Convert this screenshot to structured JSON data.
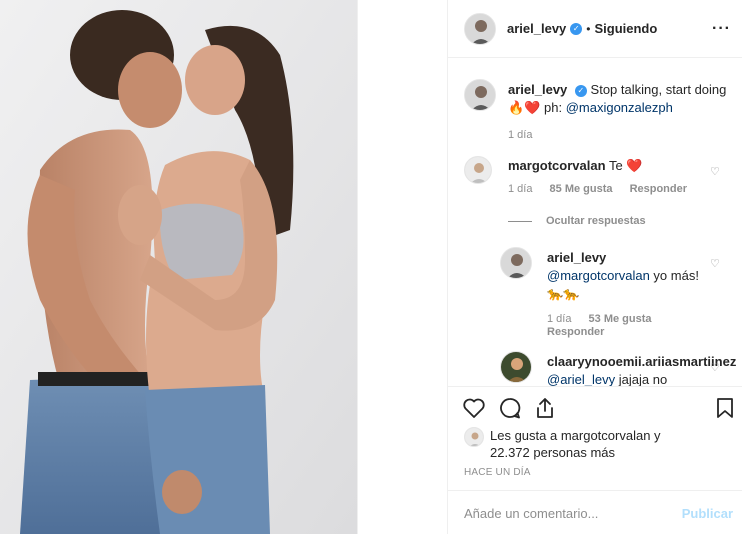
{
  "post": {
    "image_alt": "Foto de pareja besándose",
    "author": "ariel_levy",
    "follow_state": "Siguiendo",
    "separator": "•",
    "more_icon": "more-horizontal-icon"
  },
  "caption": {
    "username": "ariel_levy",
    "text": "Stop talking, start doing",
    "emojis": "🔥❤️",
    "credit_prefix": "ph:",
    "credit_mention": "@maxigonzalezph",
    "time": "1 día"
  },
  "comments": [
    {
      "username": "margotcorvalan",
      "text": "Te",
      "emoji": "❤️",
      "time": "1 día",
      "likes": "85 Me gusta",
      "reply": "Responder"
    }
  ],
  "replies_toggle": "Ocultar respuestas",
  "replies": [
    {
      "username": "ariel_levy",
      "mention": "@margotcorvalan",
      "text": "yo más!",
      "emoji": "🐆🐆",
      "time": "1 día",
      "likes": "53 Me gusta",
      "reply": "Responder"
    },
    {
      "username": "claaryynooemii.ariiasmartiinez",
      "mention": "@ariel_levy",
      "text": "jajaja no"
    }
  ],
  "actions": {
    "likes_line1": "Les gusta a margotcorvalan y",
    "likes_line2": "22.372 personas más",
    "time_ago": "HACE UN DÍA",
    "comment_placeholder": "Añade un comentario...",
    "publish_label": "Publicar"
  },
  "colors": {
    "verified": "#3897f0",
    "link": "#003569",
    "muted": "#8e8e8e",
    "heart": "#ed4956",
    "publish_disabled": "#b2dffc"
  }
}
